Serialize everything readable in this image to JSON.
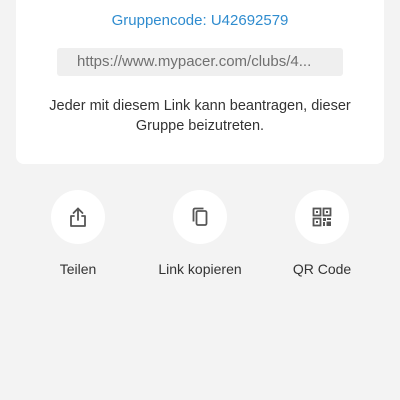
{
  "card": {
    "group_code": "Gruppencode: U42692579",
    "invite_link": "https://www.mypacer.com/clubs/4...",
    "hint": "Jeder mit diesem Link kann beantragen, dieser Gruppe beizutreten."
  },
  "actions": [
    {
      "label": "Teilen",
      "icon": "share-icon"
    },
    {
      "label": "Link kopieren",
      "icon": "copy-icon"
    },
    {
      "label": "QR Code",
      "icon": "qr-code-icon"
    }
  ],
  "colors": {
    "background": "#f3f3f3",
    "card": "#ffffff",
    "accent": "#2f8ccf",
    "link_box": "#efefef",
    "text": "#333333",
    "icon": "#555555"
  }
}
